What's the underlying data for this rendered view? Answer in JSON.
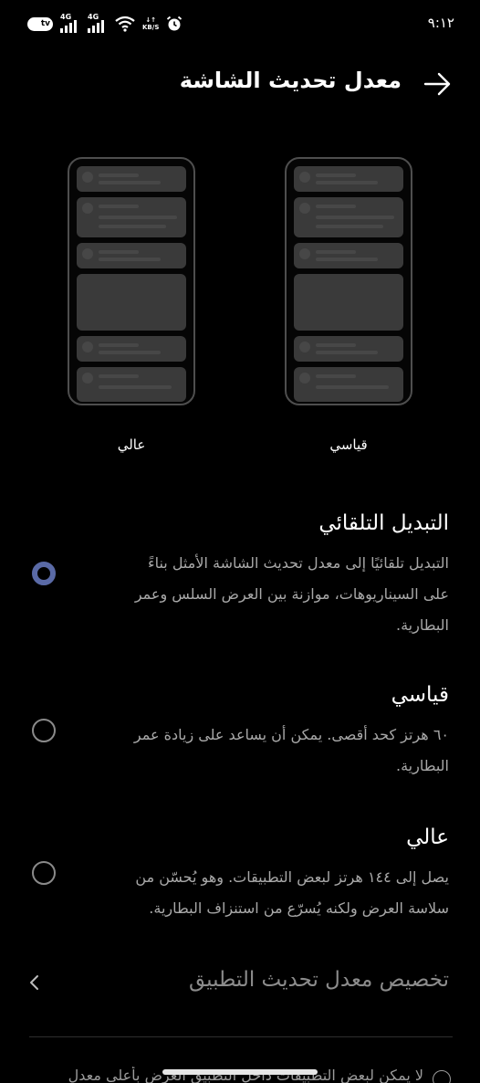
{
  "status_bar": {
    "tv_badge": "tv",
    "network_1": "4G",
    "network_2": "4G",
    "speed_unit": "KB/S",
    "time": "٩:١٢"
  },
  "header": {
    "title": "معدل تحديث الشاشة",
    "back_icon": "arrow-right-icon"
  },
  "previews": {
    "high_label": "عالي",
    "standard_label": "قياسي"
  },
  "options": [
    {
      "title": "التبديل التلقائي",
      "lines": [
        "التبديل تلقائيًا إلى معدل تحديث الشاشة الأمثل بناءً",
        "على السيناريوهات، موازنة بين العرض السلس وعمر",
        "البطارية."
      ],
      "selected": true
    },
    {
      "title": "قياسي",
      "lines": [
        "٦٠ هرتز كحد أقصى. يمكن أن يساعد على زيادة عمر",
        "البطارية."
      ],
      "selected": false
    },
    {
      "title": "عالي",
      "lines": [
        "يصل إلى ١٤٤ هرتز لبعض التطبيقات. وهو يُحسّن من",
        "سلاسة العرض ولكنه يُسرّع من استنزاف البطارية."
      ],
      "selected": false
    }
  ],
  "customize": {
    "label": "تخصيص معدل تحديث التطبيق"
  },
  "info": {
    "text": "لا يمكن لبعض التطبيقات داخل التطبيق العرض بأعلى معدل"
  },
  "colors": {
    "accent": "#5a6aa6",
    "background": "#000000"
  }
}
